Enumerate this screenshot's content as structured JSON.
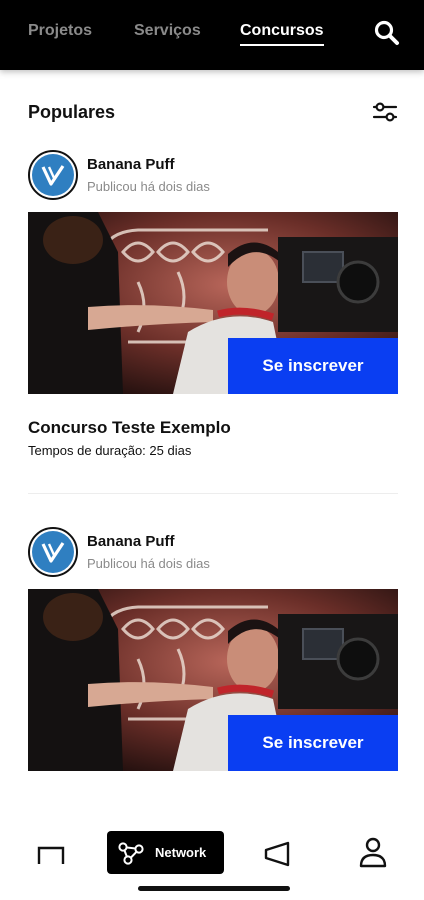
{
  "header": {
    "tabs": [
      {
        "label": "Projetos",
        "active": false
      },
      {
        "label": "Serviços",
        "active": false
      },
      {
        "label": "Concursos",
        "active": true
      }
    ],
    "search_icon": "search-icon"
  },
  "section": {
    "title": "Populares",
    "filter_icon": "filter-sliders-icon"
  },
  "posts": [
    {
      "author": "Banana Puff",
      "meta": "Publicou há dois dias",
      "cta_label": "Se inscrever",
      "contest_title": "Concurso Teste Exemplo",
      "duration": "Tempos de duração: 25 dias"
    },
    {
      "author": "Banana Puff",
      "meta": "Publicou há dois dias",
      "cta_label": "Se inscrever"
    }
  ],
  "bottom_nav": {
    "items": [
      {
        "icon": "home-icon"
      },
      {
        "icon": "network-icon",
        "label": "Network",
        "active": true
      },
      {
        "icon": "megaphone-icon"
      },
      {
        "icon": "profile-icon"
      }
    ]
  },
  "colors": {
    "accent": "#0a3ef2",
    "topbar": "#000000",
    "avatar_blue": "#2f7fc1"
  }
}
